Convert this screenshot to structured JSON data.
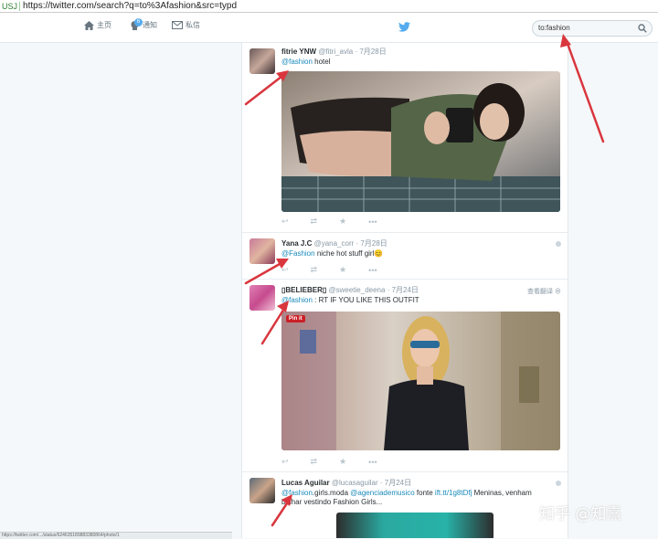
{
  "browser": {
    "security_label": "USJ",
    "url": "https://twitter.com/search?q=to%3Afashion&src=typd"
  },
  "nav": {
    "home": "主页",
    "notifications": "通知",
    "notifications_badge": "6",
    "messages": "私信"
  },
  "search": {
    "value": "to:fashion"
  },
  "tweets": [
    {
      "name": "fitrie YNW",
      "handle": "@fitri_avla",
      "time": "7月28日",
      "mention": "@fashion",
      "text": " hotel",
      "text2": ""
    },
    {
      "name": "Yana J.C",
      "handle": "@yana_corr",
      "time": "7月28日",
      "mention": "@Fashion",
      "text": " niche hot stuff girl😊",
      "text2": ""
    },
    {
      "name": "▯BELIEBER▯",
      "handle": "@sweetie_deena",
      "time": "7月24日",
      "mention": "@fashion",
      "text": " : RT IF YOU LIKE THIS OUTFIT",
      "text2": "",
      "translate": "查看翻译",
      "pin": "Pin it"
    },
    {
      "name": "Lucas Aguilar",
      "handle": "@lucasaguilar",
      "time": "7月24日",
      "mention": "@fashion",
      "text": ".girls.moda ",
      "mention2": "@agenciademusico",
      "text_b": " fonte ",
      "link": "ift.tt/1g8tDfj",
      "text_c": " Meninas, venham",
      "text2": "brilhar  vestindo Fashion Girls..."
    }
  ],
  "status_url": "https://twitter.com/.../status/624635189883380864/photo/1",
  "watermark": "知乎 @知熹",
  "colors": {
    "accent": "#55acee",
    "link": "#1a8abb",
    "arrow": "#d9363e"
  }
}
